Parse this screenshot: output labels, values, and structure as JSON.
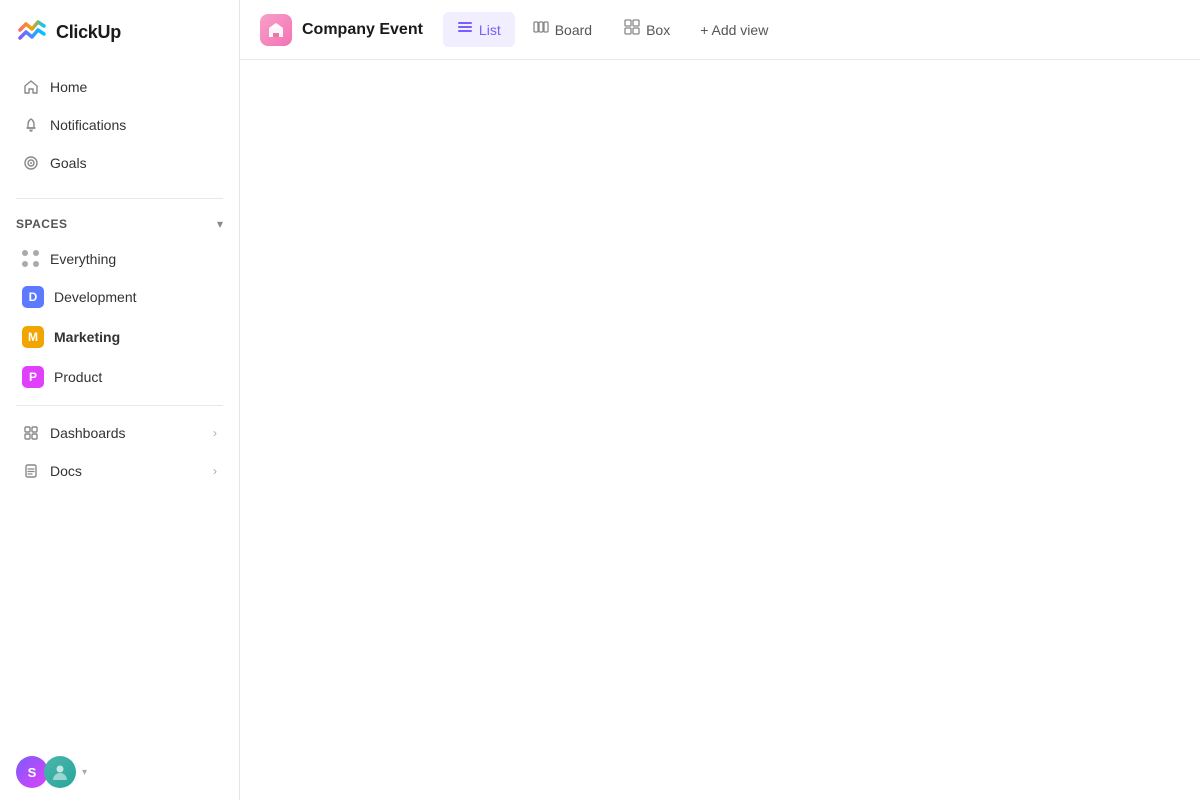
{
  "app": {
    "name": "ClickUp"
  },
  "sidebar": {
    "nav": [
      {
        "id": "home",
        "label": "Home",
        "icon": "home-icon"
      },
      {
        "id": "notifications",
        "label": "Notifications",
        "icon": "bell-icon"
      },
      {
        "id": "goals",
        "label": "Goals",
        "icon": "goals-icon"
      }
    ],
    "spaces_label": "Spaces",
    "spaces": [
      {
        "id": "everything",
        "label": "Everything",
        "type": "dots"
      },
      {
        "id": "development",
        "label": "Development",
        "type": "avatar",
        "letter": "D",
        "color": "#5b7aff"
      },
      {
        "id": "marketing",
        "label": "Marketing",
        "type": "avatar",
        "letter": "M",
        "color": "#f0a500",
        "bold": true
      },
      {
        "id": "product",
        "label": "Product",
        "type": "avatar",
        "letter": "P",
        "color": "#e040fb"
      }
    ],
    "sections": [
      {
        "id": "dashboards",
        "label": "Dashboards"
      },
      {
        "id": "docs",
        "label": "Docs"
      }
    ],
    "footer": {
      "avatar_s_label": "S",
      "dropdown_char": "▾"
    }
  },
  "header": {
    "breadcrumb_title": "Company Event",
    "views": [
      {
        "id": "list",
        "label": "List",
        "active": true
      },
      {
        "id": "board",
        "label": "Board",
        "active": false
      },
      {
        "id": "box",
        "label": "Box",
        "active": false
      }
    ],
    "add_view_label": "+ Add view"
  }
}
